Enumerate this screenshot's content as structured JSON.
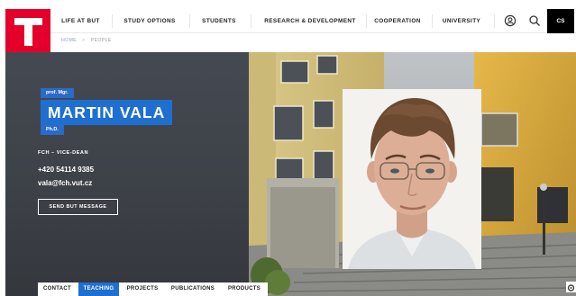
{
  "header": {
    "nav": [
      "LIFE AT BUT",
      "STUDY OPTIONS",
      "STUDENTS",
      "RESEARCH & DEVELOPMENT",
      "COOPERATION",
      "UNIVERSITY"
    ],
    "lang": "CS",
    "icons": [
      "user-icon",
      "search-icon"
    ]
  },
  "breadcrumb": {
    "home": "HOME",
    "separator": ">",
    "current": "PEOPLE"
  },
  "profile": {
    "prefix": "prof. Mgr.",
    "name": "MARTIN VALA",
    "suffix": "Ph.D.",
    "role": "FCH – VICE-DEAN",
    "phone": "+420 54114 9385",
    "email": "vala@fch.vut.cz",
    "send_button": "SEND BUT MESSAGE"
  },
  "tabs": {
    "items": [
      "CONTACT",
      "TEACHING",
      "PROJECTS",
      "PUBLICATIONS",
      "PRODUCTS"
    ],
    "active": "TEACHING"
  },
  "colors": {
    "brand_red": "#e4002b",
    "accent_blue": "#1f6fd1",
    "panel_gray": "#41454c",
    "lang_bg": "#000000"
  }
}
